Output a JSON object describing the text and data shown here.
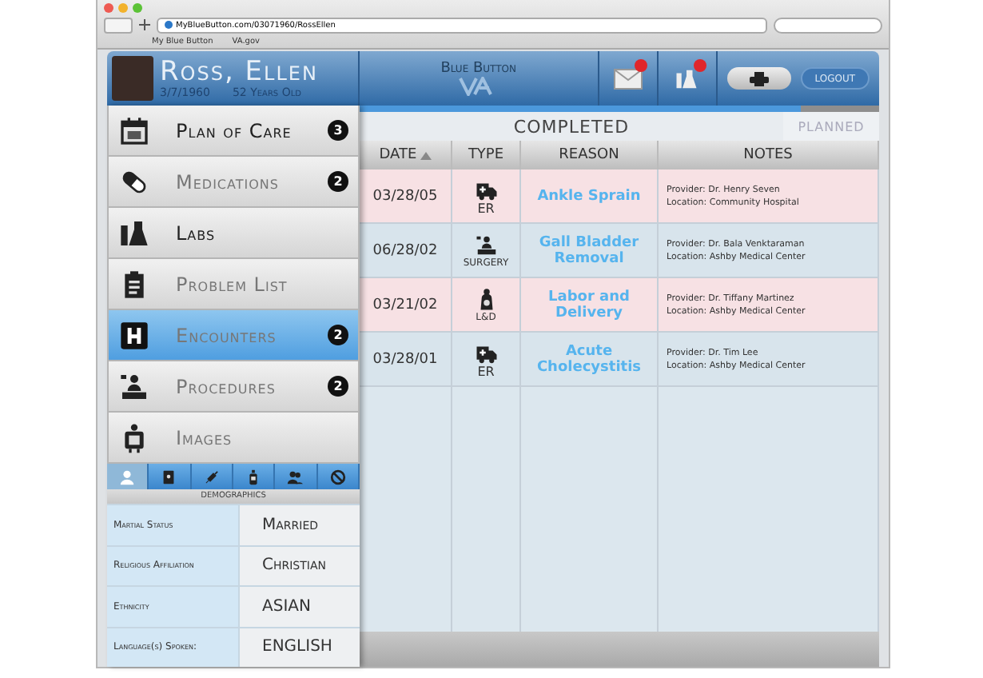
{
  "browser": {
    "url": "MyBlueButton.com/03071960/RossEllen",
    "bookmarks": [
      "My Blue Button",
      "VA.gov"
    ]
  },
  "patient": {
    "name": "Ross, Ellen",
    "dob": "3/7/1960",
    "age": "52 Years Old"
  },
  "brand": {
    "title": "Blue Button"
  },
  "header_actions": {
    "logout": "LOGOUT"
  },
  "sidebar": {
    "items": [
      {
        "kind": "calendar",
        "label": "Plan of Care",
        "badge": "3",
        "selected": false,
        "dimmed": false
      },
      {
        "kind": "pill",
        "label": "Medications",
        "badge": "2",
        "selected": false,
        "dimmed": true
      },
      {
        "kind": "flask",
        "label": "Labs",
        "selected": false,
        "dimmed": false
      },
      {
        "kind": "clipboard",
        "label": "Problem List",
        "selected": false,
        "dimmed": true
      },
      {
        "kind": "hospital",
        "label": "Encounters",
        "badge": "2",
        "selected": true,
        "dimmed": true
      },
      {
        "kind": "surgery",
        "label": "Procedures",
        "badge": "2",
        "selected": false,
        "dimmed": true
      },
      {
        "kind": "xray",
        "label": "Images",
        "selected": false,
        "dimmed": true
      }
    ]
  },
  "info_tabs": [
    {
      "kind": "person",
      "selected": true
    },
    {
      "kind": "book",
      "selected": false
    },
    {
      "kind": "syringe",
      "selected": false
    },
    {
      "kind": "bottle",
      "selected": false
    },
    {
      "kind": "people",
      "selected": false
    },
    {
      "kind": "blocked",
      "selected": false
    }
  ],
  "demographics": {
    "title": "DEMOGRAPHICS",
    "rows": [
      {
        "label": "Martial Status",
        "value": "Married"
      },
      {
        "label": "Religious Affiliation",
        "value": "Christian"
      },
      {
        "label": "Ethnicity",
        "value": "ASIAN"
      },
      {
        "label": "Language(s) Spoken:",
        "value": "ENGLISH"
      }
    ]
  },
  "progress": {
    "level": 0.85
  },
  "tabs": [
    {
      "label": "COMPLETED",
      "selected": true
    },
    {
      "label": "PLANNED",
      "selected": false
    }
  ],
  "table": {
    "columns": [
      "DATE",
      "TYPE",
      "REASON",
      "NOTES"
    ],
    "rows": [
      {
        "date": "03/28/05",
        "kind": "er",
        "type": "ER",
        "reason": "Ankle Sprain",
        "provider": "Provider: Dr. Henry Seven",
        "location": "Location: Community Hospital"
      },
      {
        "date": "06/28/02",
        "kind": "surgery",
        "type": "SURGERY",
        "reason": "Gall Bladder Removal",
        "provider": "Provider: Dr. Bala Venktaraman",
        "location": "Location: Ashby Medical Center"
      },
      {
        "date": "03/21/02",
        "kind": "ld",
        "type": "L&D",
        "reason": "Labor and Delivery",
        "provider": "Provider: Dr. Tiffany Martinez",
        "location": "Location: Ashby Medical Center"
      },
      {
        "date": "03/28/01",
        "kind": "er",
        "type": "ER",
        "reason": "Acute Cholecystitis",
        "provider": "Provider: Dr. Tim Lee",
        "location": "Location: Ashby Medical Center"
      }
    ]
  }
}
